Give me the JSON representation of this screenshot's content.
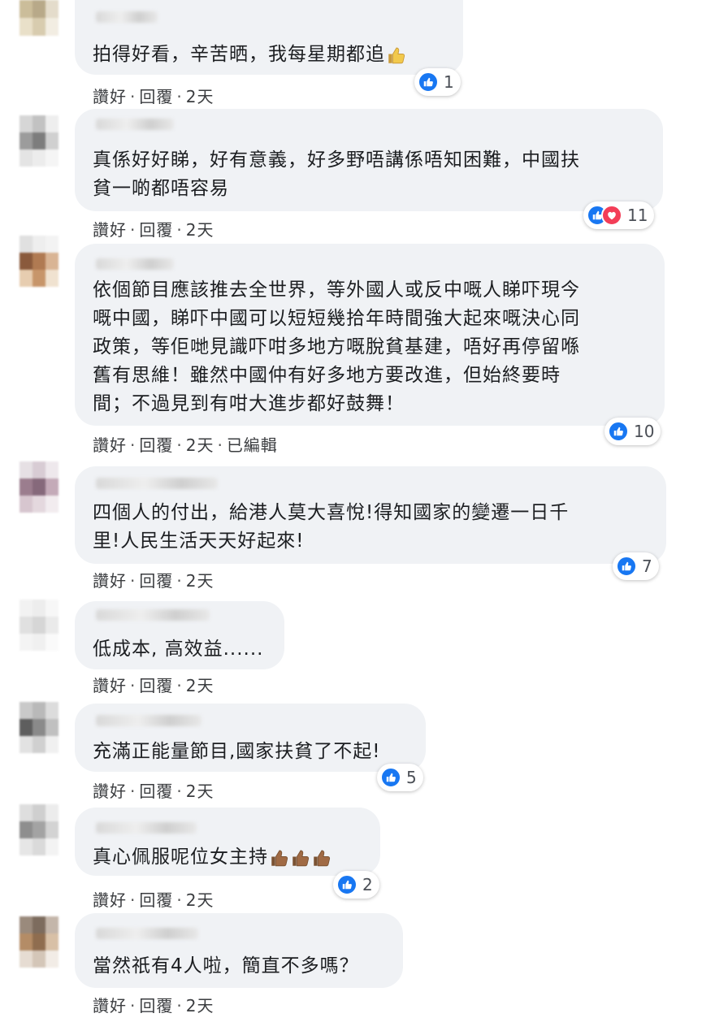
{
  "actions": {
    "like": "讚好",
    "reply": "回覆",
    "sep": "·",
    "edited": "已編輯"
  },
  "colors": {
    "like_blue": "#1877f2",
    "love_red": "#f33e58",
    "bubble": "#f0f2f5"
  },
  "icons": {
    "like": "thumbs-up-icon",
    "love": "heart-icon",
    "thumb_emoji": "thumbs-up-emoji"
  },
  "comments": [
    {
      "text": "拍得好看，辛苦晒，我每星期都追",
      "time": "2天",
      "reactions": "1"
    },
    {
      "text": "真係好好睇，好有意義，好多野唔講係唔知困難，中國扶\n貧一啲都唔容易",
      "time": "2天",
      "reactions": "11"
    },
    {
      "text": "依個節目應該推去全世界，等外國人或反中嘅人睇吓現今\n嘅中國，睇吓中國可以短短幾拾年時間強大起來嘅決心同\n政策，等佢哋見識吓咁多地方嘅脫貧基建，唔好再停留喺\n舊有思維！雖然中國仲有好多地方要改進，但始終要時\n間；不過見到有咁大進步都好鼓舞！",
      "time": "2天",
      "reactions": "10"
    },
    {
      "text": "四個人的付出，給港人莫大喜悅!得知國家的變遷一日千\n里!人民生活天天好起來!",
      "time": "2天",
      "reactions": "7"
    },
    {
      "text": "低成本, 高效益......",
      "time": "2天",
      "reactions": ""
    },
    {
      "text": "充滿正能量節目,國家扶貧了不起!",
      "time": "2天",
      "reactions": "5"
    },
    {
      "text": "真心佩服呢位女主持",
      "time": "2天",
      "reactions": "2"
    },
    {
      "text": "當然祇有4人啦，簡直不多嗎？",
      "time": "2天",
      "reactions": ""
    }
  ]
}
